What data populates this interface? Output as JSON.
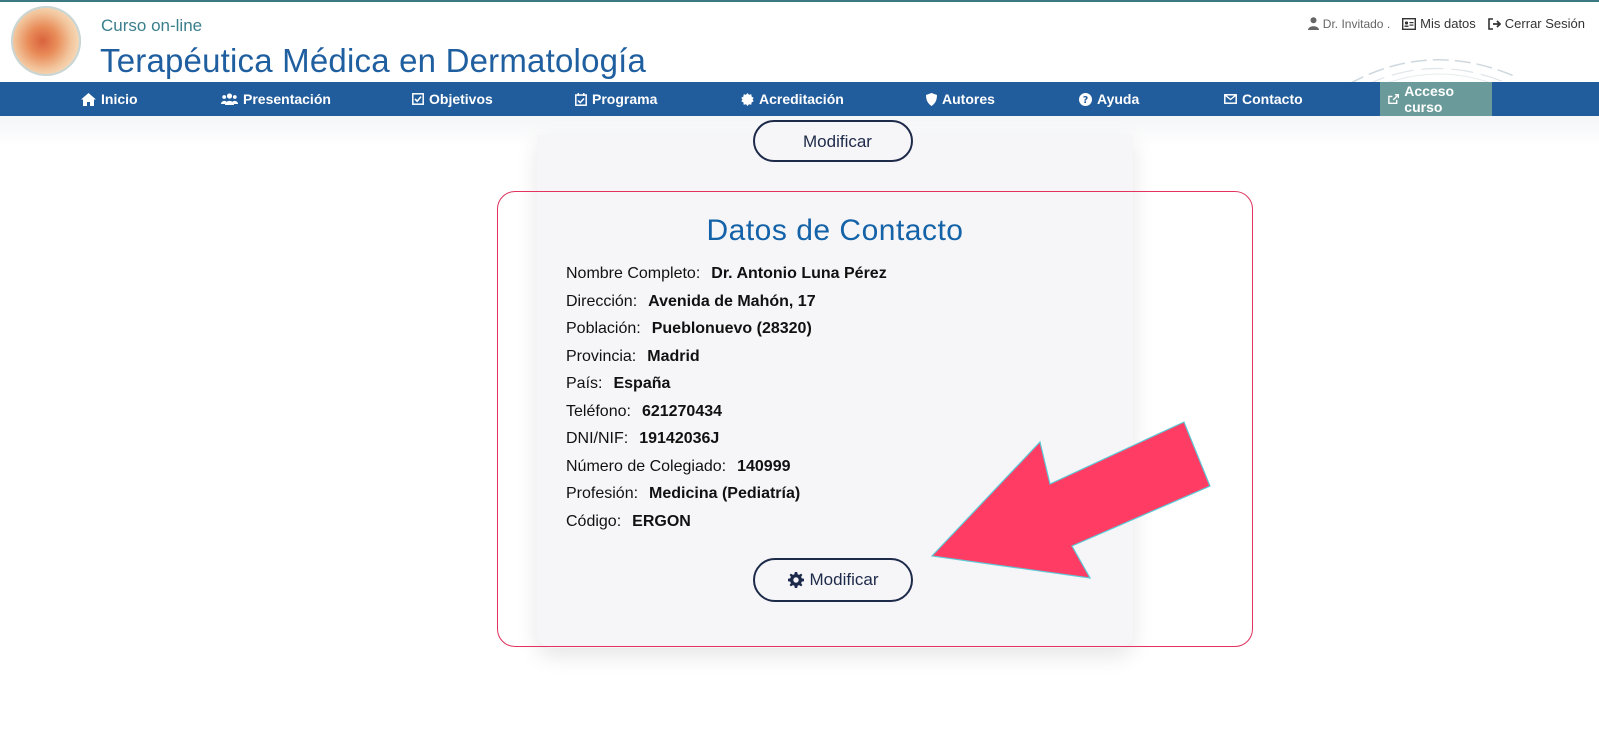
{
  "header": {
    "subtitle": "Curso on-line",
    "title": "Terapéutica Médica en Dermatología",
    "user_name": "Dr. Invitado .",
    "my_data": "Mis datos",
    "logout": "Cerrar Sesión"
  },
  "nav": {
    "items": [
      {
        "label": "Inicio",
        "icon": "home-icon"
      },
      {
        "label": "Presentación",
        "icon": "users-icon"
      },
      {
        "label": "Objetivos",
        "icon": "check-square-icon"
      },
      {
        "label": "Programa",
        "icon": "calendar-check-icon"
      },
      {
        "label": "Acreditación",
        "icon": "badge-icon"
      },
      {
        "label": "Autores",
        "icon": "shield-icon"
      },
      {
        "label": "Ayuda",
        "icon": "question-circle-icon"
      },
      {
        "label": "Contacto",
        "icon": "envelope-icon"
      },
      {
        "label": "Acceso curso",
        "icon": "external-link-icon"
      }
    ]
  },
  "top_button": {
    "label": "Modificar"
  },
  "contact": {
    "title": "Datos de Contacto",
    "fields": [
      {
        "label": "Nombre Completo:",
        "value": "Dr. Antonio Luna Pérez"
      },
      {
        "label": "Dirección:",
        "value": "Avenida de Mahón, 17"
      },
      {
        "label": "Población:",
        "value": "Pueblonuevo (28320)"
      },
      {
        "label": "Provincia:",
        "value": "Madrid"
      },
      {
        "label": "País:",
        "value": "España"
      },
      {
        "label": "Teléfono:",
        "value": "621270434"
      },
      {
        "label": "DNI/NIF:",
        "value": "19142036J"
      },
      {
        "label": "Número de Colegiado:",
        "value": "140999"
      },
      {
        "label": "Profesión:",
        "value": "Medicina (Pediatría)"
      },
      {
        "label": "Código:",
        "value": "ERGON"
      }
    ],
    "modify_button": "Modificar"
  },
  "colors": {
    "nav_bg": "#215c9c",
    "nav_active": "#6a9b9a",
    "title": "#1f5fa0",
    "card_title": "#1463a8",
    "highlight": "#e0345f",
    "arrow": "#ff3d64"
  }
}
